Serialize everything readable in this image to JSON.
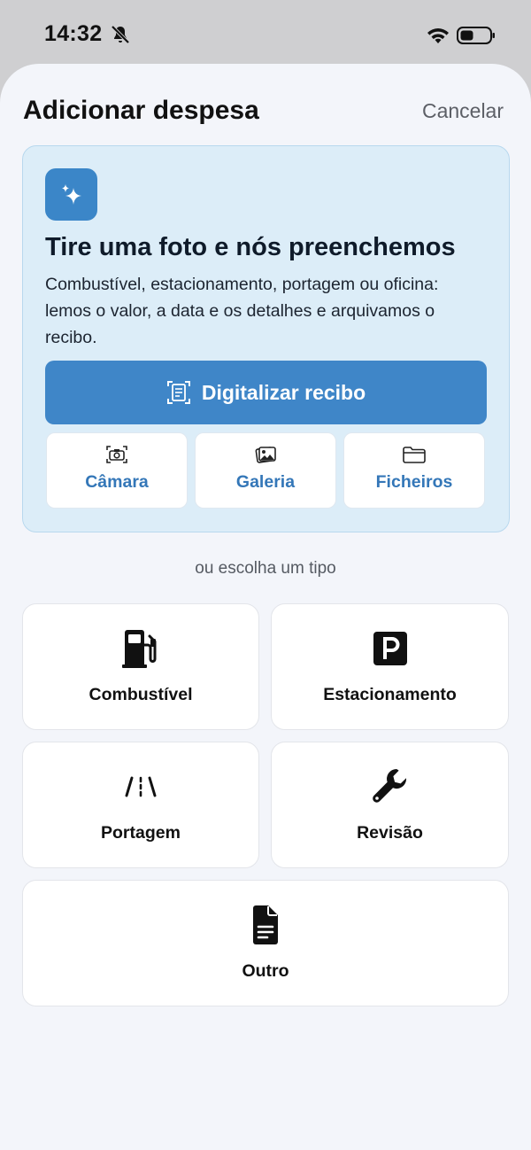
{
  "status_bar": {
    "time": "14:32",
    "icons": [
      "bell-slash-icon",
      "wifi-icon",
      "battery-icon"
    ]
  },
  "header": {
    "title": "Adicionar despesa",
    "cancel_label": "Cancelar"
  },
  "scan_card": {
    "icon": "sparkles-icon",
    "heading": "Tire uma foto e nós preenchemos",
    "description": "Combustível, estacionamento, portagem ou oficina: lemos o valor, a data e os detalhes e arquivamos o recibo.",
    "scan_button": {
      "label": "Digitalizar recibo",
      "icon": "document-scan-icon"
    },
    "sources": [
      {
        "label": "Câmara",
        "icon": "camera-icon"
      },
      {
        "label": "Galeria",
        "icon": "photo-gallery-icon"
      },
      {
        "label": "Ficheiros",
        "icon": "folder-icon"
      }
    ]
  },
  "divider_text": "ou escolha um tipo",
  "types": [
    {
      "label": "Combustível",
      "icon": "fuel-pump-icon"
    },
    {
      "label": "Estacionamento",
      "icon": "parking-icon"
    },
    {
      "label": "Portagem",
      "icon": "road-icon"
    },
    {
      "label": "Revisão",
      "icon": "wrench-icon"
    },
    {
      "label": "Outro",
      "icon": "document-icon"
    }
  ],
  "colors": {
    "accent": "#3f86c8",
    "card_background": "#dcedf8",
    "sheet_background": "#f3f5fa",
    "source_label": "#3477b8"
  }
}
